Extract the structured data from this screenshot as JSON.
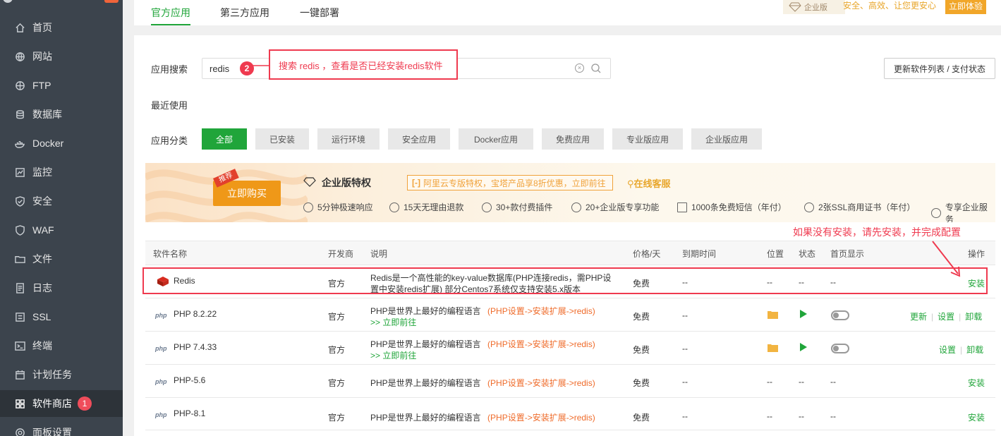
{
  "sidebar": {
    "items": [
      {
        "label": "首页",
        "icon": "home-icon"
      },
      {
        "label": "网站",
        "icon": "globe-icon"
      },
      {
        "label": "FTP",
        "icon": "ftp-icon"
      },
      {
        "label": "数据库",
        "icon": "database-icon"
      },
      {
        "label": "Docker",
        "icon": "docker-icon"
      },
      {
        "label": "监控",
        "icon": "monitor-icon"
      },
      {
        "label": "安全",
        "icon": "shield-icon"
      },
      {
        "label": "WAF",
        "icon": "waf-icon"
      },
      {
        "label": "文件",
        "icon": "folder-icon"
      },
      {
        "label": "日志",
        "icon": "log-icon"
      },
      {
        "label": "SSL",
        "icon": "ssl-icon"
      },
      {
        "label": "终端",
        "icon": "terminal-icon"
      },
      {
        "label": "计划任务",
        "icon": "calendar-icon"
      },
      {
        "label": "软件商店",
        "icon": "grid-icon",
        "badge": "1"
      },
      {
        "label": "面板设置",
        "icon": "gear-icon"
      }
    ]
  },
  "topbar": {
    "tabs": [
      "官方应用",
      "第三方应用",
      "一键部署"
    ],
    "enterprise_tag": "企业版",
    "enterprise_slogan": "安全、高效、让您更安心",
    "enterprise_button": "立即体验"
  },
  "search": {
    "label": "应用搜索",
    "value": "redis",
    "step": "2",
    "annotation": "搜索 redis ，查看是否已经安装redis软件"
  },
  "refresh_button": "更新软件列表 / 支付状态",
  "recent_label": "最近使用",
  "category": {
    "label": "应用分类",
    "items": [
      "全部",
      "已安装",
      "运行环境",
      "安全应用",
      "Docker应用",
      "免费应用",
      "专业版应用",
      "企业版应用"
    ]
  },
  "promo": {
    "buy_button": "立即购买",
    "buy_tag": "推荐",
    "title": "企业版特权",
    "aliyun": "阿里云专版特权，宝塔产品享8折优惠，立即前往",
    "online": "在线客服",
    "perks": [
      "5分钟极速响应",
      "15天无理由退款",
      "30+款付费插件",
      "20+企业版专享功能",
      "1000条免费短信（年付）",
      "2张SSL商用证书（年付）",
      "专享企业服务"
    ]
  },
  "install_note": "如果没有安装，请先安装，并完成配置",
  "table": {
    "headers": [
      "软件名称",
      "开发商",
      "说明",
      "价格/天",
      "到期时间",
      "位置",
      "状态",
      "首页显示",
      "操作"
    ],
    "rows": [
      {
        "name": "Redis",
        "vendor": "官方",
        "desc1": "Redis是一个高性能的key-value数据库(PHP连接redis，需PHP设",
        "desc2": "置中安装redis扩展) 部分Centos7系统仅支持安装5.x版本",
        "price": "免费",
        "expire": "--",
        "loc": "--",
        "status": "--",
        "home": "--",
        "actions": [
          "安装"
        ]
      },
      {
        "name": "PHP 8.2.22",
        "vendor": "官方",
        "desc1": "PHP是世界上最好的编程语言",
        "desc_path": "(PHP设置->安装扩展->redis)",
        "desc_link": ">> 立即前往",
        "price": "免费",
        "expire": "--",
        "actions": [
          "更新",
          "设置",
          "卸载"
        ]
      },
      {
        "name": "PHP 7.4.33",
        "vendor": "官方",
        "desc1": "PHP是世界上最好的编程语言",
        "desc_path": "(PHP设置->安装扩展->redis)",
        "desc_link": ">> 立即前往",
        "price": "免费",
        "expire": "--",
        "actions": [
          "设置",
          "卸载"
        ]
      },
      {
        "name": "PHP-5.6",
        "vendor": "官方",
        "desc1": "PHP是世界上最好的编程语言",
        "desc_path": "(PHP设置->安装扩展->redis)",
        "price": "免费",
        "expire": "--",
        "loc": "--",
        "status": "--",
        "home": "--",
        "actions": [
          "安装"
        ]
      },
      {
        "name": "PHP-8.1",
        "vendor": "官方",
        "desc1": "PHP是世界上最好的编程语言",
        "desc_path": "(PHP设置->安装扩展->redis)",
        "price": "免费",
        "expire": "--",
        "loc": "--",
        "status": "--",
        "home": "--",
        "actions": [
          "安装"
        ]
      }
    ]
  },
  "php_tag": "php"
}
